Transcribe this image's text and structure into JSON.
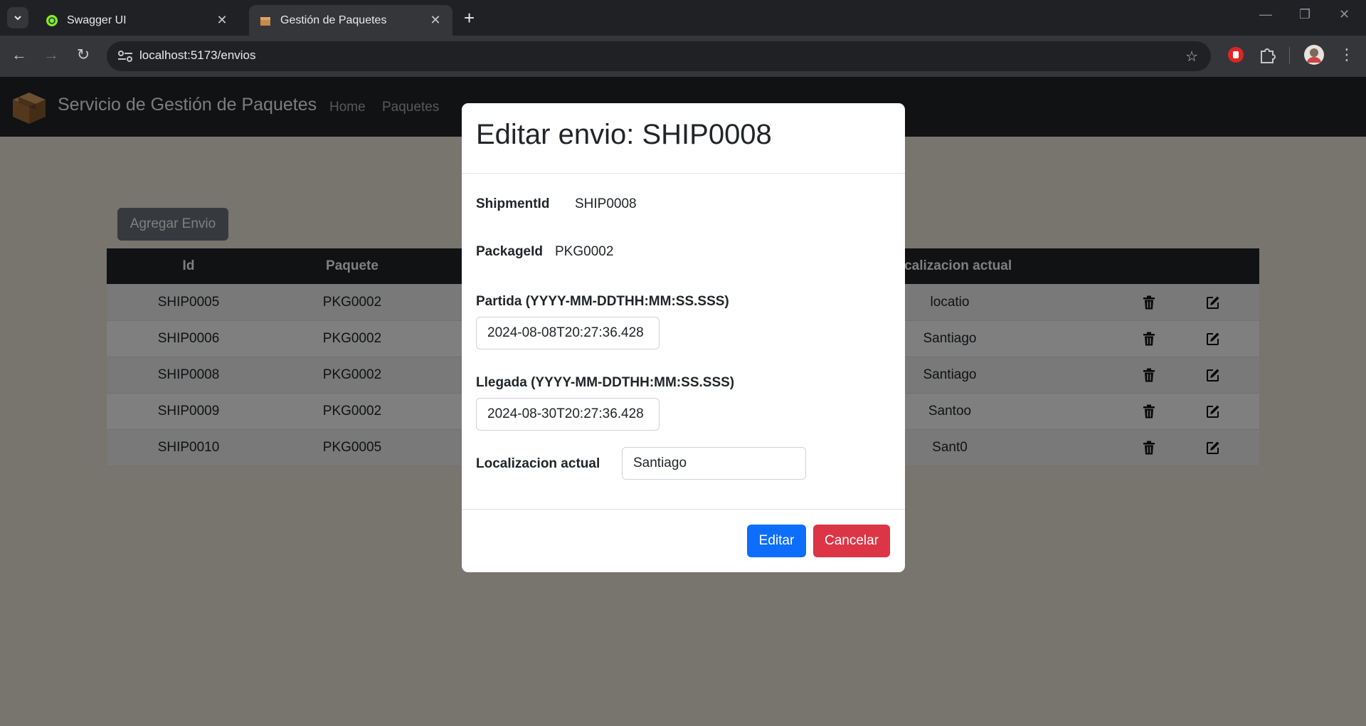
{
  "browser": {
    "tabs": [
      {
        "title": "Swagger UI",
        "icon": "swagger-icon"
      },
      {
        "title": "Gestión de Paquetes",
        "icon": "package-icon",
        "active": true
      }
    ],
    "url": "localhost:5173/envios"
  },
  "navbar": {
    "brand": "Servicio de Gestión de Paquetes",
    "links": [
      "Home",
      "Paquetes"
    ]
  },
  "main": {
    "add_button": "Agregar Envio",
    "table": {
      "headers": {
        "id": "Id",
        "package": "Paquete",
        "location": "Localizacion actual"
      },
      "rows": [
        {
          "id": "SHIP0005",
          "package": "PKG0002",
          "location": "locatio"
        },
        {
          "id": "SHIP0006",
          "package": "PKG0002",
          "location": "Santiago"
        },
        {
          "id": "SHIP0008",
          "package": "PKG0002",
          "location": "Santiago"
        },
        {
          "id": "SHIP0009",
          "package": "PKG0002",
          "location": "Santoo"
        },
        {
          "id": "SHIP0010",
          "package": "PKG0005",
          "location": "Sant0"
        }
      ]
    }
  },
  "modal": {
    "title": "Editar envio: SHIP0008",
    "shipment_label": "ShipmentId",
    "shipment_value": "SHIP0008",
    "package_label": "PackageId",
    "package_value": "PKG0002",
    "departure_label": "Partida (YYYY-MM-DDTHH:MM:SS.SSS)",
    "departure_value": "2024-08-08T20:27:36.428",
    "arrival_label": "Llegada (YYYY-MM-DDTHH:MM:SS.SSS)",
    "arrival_value": "2024-08-30T20:27:36.428",
    "location_label": "Localizacion actual",
    "location_value": "Santiago",
    "edit_button": "Editar",
    "cancel_button": "Cancelar"
  },
  "colors": {
    "primary": "#0d6efd",
    "danger": "#dc3545",
    "navbar": "#212529",
    "secondary": "#6c757d"
  }
}
